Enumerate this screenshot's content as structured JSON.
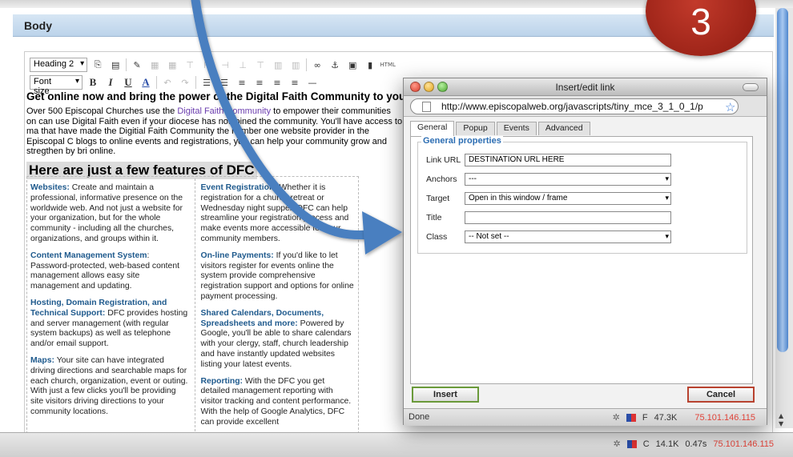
{
  "header": {
    "title": "Body"
  },
  "toolbar": {
    "format_select": "Heading 2",
    "fontsize_select": "Font size",
    "bold": "B",
    "italic": "I",
    "underline": "U",
    "forecolor": "A",
    "hr": "—",
    "html_label": "HTML"
  },
  "content": {
    "heading": "Get online now and bring the power of the Digital Faith Community to your P",
    "para_1": "Over 500 Episcopal Churches use the ",
    "para_link": "Digital Faith Community",
    "para_2": " to empower their communities on can use Digital Faith even if your diocese has not joined the community. You'll have access to ma that have made the Digitial Faith Community the number one website provider in the Episcopal C blogs to online events and registrations, you can help your community grow and stregthen by bri online.",
    "features_heading": "Here are just a few features of DFC",
    "col_left": [
      {
        "title": "Websites:",
        "text": " Create and maintain a professional, informative presence on the worldwide web. And not just a website for your organization, but for the whole community - including all the churches, organizations, and groups within it."
      },
      {
        "title": "Content Management System",
        "text": ": Password-protected, web-based content management allows easy site management and updating."
      },
      {
        "title": "Hosting, Domain Registration, and Technical Support:",
        "text": " DFC provides hosting and server management (with regular system backups) as well as telephone and/or email support."
      },
      {
        "title": "Maps:",
        "text": " Your site can have integrated driving directions and searchable maps for each church, organization, event or outing. With just a few clicks you'll be providing site visitors driving directions to your community locations."
      }
    ],
    "col_right": [
      {
        "title": "Event Registration:",
        "text": " Whether it is registration for a church retreat or Wednesday night supper, DFC can help streamline your registration process and make events more accessible for your community members."
      },
      {
        "title": "On-line Payments:",
        "text": " If you'd like to let visitors register for events online the system provide comprehensive registration support and options for online payment processing."
      },
      {
        "title": "Shared Calendars, Documents, Spreadsheets and more:",
        "text": " Powered by Google, you'll be able to share calendars with your clergy, staff, church leadership and have instantly updated websites listing your latest events."
      },
      {
        "title": "Reporting:",
        "text": " With the DFC you get detailed management reporting with visitor tracking and content performance. With the help of Google Analytics, DFC can provide excellent"
      }
    ]
  },
  "badge": {
    "number": "3"
  },
  "dialog": {
    "title": "Insert/edit link",
    "url": "http://www.episcopalweb.org/javascripts/tiny_mce_3_1_0_1/p",
    "tabs": [
      "General",
      "Popup",
      "Events",
      "Advanced"
    ],
    "legend": "General properties",
    "fields": {
      "link_url_label": "Link URL",
      "link_url_value": "DESTINATION URL HERE",
      "anchors_label": "Anchors",
      "anchors_value": "---",
      "target_label": "Target",
      "target_value": "Open in this window / frame",
      "title_label": "Title",
      "title_value": "",
      "class_label": "Class",
      "class_value": "-- Not set --"
    },
    "insert_label": "Insert",
    "cancel_label": "Cancel",
    "status": {
      "left": "Done",
      "letter": "F",
      "size": "47.3K",
      "ip": "75.101.146.115"
    }
  },
  "main_status": {
    "letter": "C",
    "size": "14.1K",
    "time": "0.47s",
    "ip": "75.101.146.115"
  },
  "colors": {
    "accent_blue": "#2d6eb3",
    "badge_red": "#a82a1c",
    "arrow_blue": "#4a7fc0",
    "ip_red": "#e0443a"
  }
}
